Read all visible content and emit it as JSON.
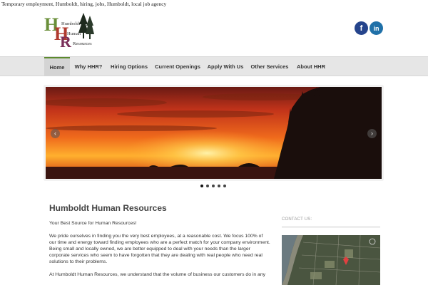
{
  "site": {
    "tagline": "Temporary employment, Humboldt, hiring, jobs, Humboldt, local job agency"
  },
  "logo": {
    "letters": [
      "H",
      "H",
      "R"
    ],
    "words": [
      "Humboldt",
      "Human",
      "Resources"
    ]
  },
  "social": {
    "facebook_label": "f",
    "linkedin_label": "in"
  },
  "nav": {
    "items": [
      {
        "label": "Home"
      },
      {
        "label": "Why HHR?"
      },
      {
        "label": "Hiring Options"
      },
      {
        "label": "Current Openings"
      },
      {
        "label": "Apply With Us"
      },
      {
        "label": "Other Services"
      },
      {
        "label": "About HHR"
      }
    ],
    "active_index": 0
  },
  "slider": {
    "prev_label": "‹",
    "next_label": "›",
    "slide_count": 5,
    "active_slide": 1
  },
  "main": {
    "title": "Humboldt Human Resources",
    "paragraphs": [
      "Your Best Source for Human Resources!",
      "We pride ourselves in finding you the very best employees, at a reasonable cost.  We focus 100% of our time and energy toward finding employees who are a perfect match for your company environment.  Being small and locally owned, we are better equipped to deal with your needs than the larger corporate services who seem to have forgotten that they are dealing with real people who need real solutions to their problems.",
      "At Humboldt Human Resources, we understand that the volume of business our customers do in any"
    ]
  },
  "sidebar": {
    "contact_label": "CONTACT US:"
  },
  "colors": {
    "nav_bg": "#e6e6e6",
    "nav_active_accent": "#5c8a2e",
    "facebook": "#25448c",
    "linkedin": "#1f70a8"
  }
}
